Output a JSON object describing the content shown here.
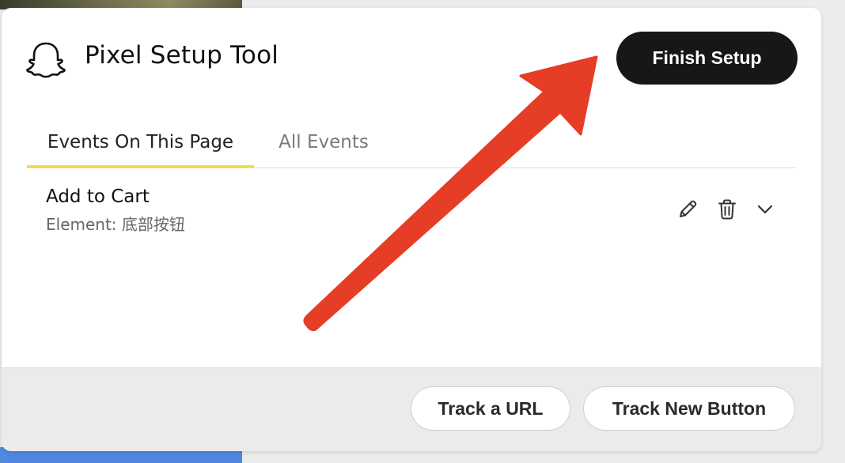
{
  "header": {
    "title": "Pixel Setup Tool",
    "finish_label": "Finish Setup",
    "logo_icon": "ghost-icon"
  },
  "tabs": [
    {
      "label": "Events On This Page",
      "active": true
    },
    {
      "label": "All Events",
      "active": false
    }
  ],
  "events": [
    {
      "name": "Add to Cart",
      "element": "Element: 底部按钮",
      "actions": [
        "pencil-icon",
        "trash-icon",
        "chevron-down-icon"
      ]
    }
  ],
  "footer": {
    "track_url_label": "Track a URL",
    "track_button_label": "Track New Button"
  },
  "colors": {
    "accent_tab": "#f2d94e",
    "finish_bg": "#161817",
    "arrow": "#e63d26"
  }
}
